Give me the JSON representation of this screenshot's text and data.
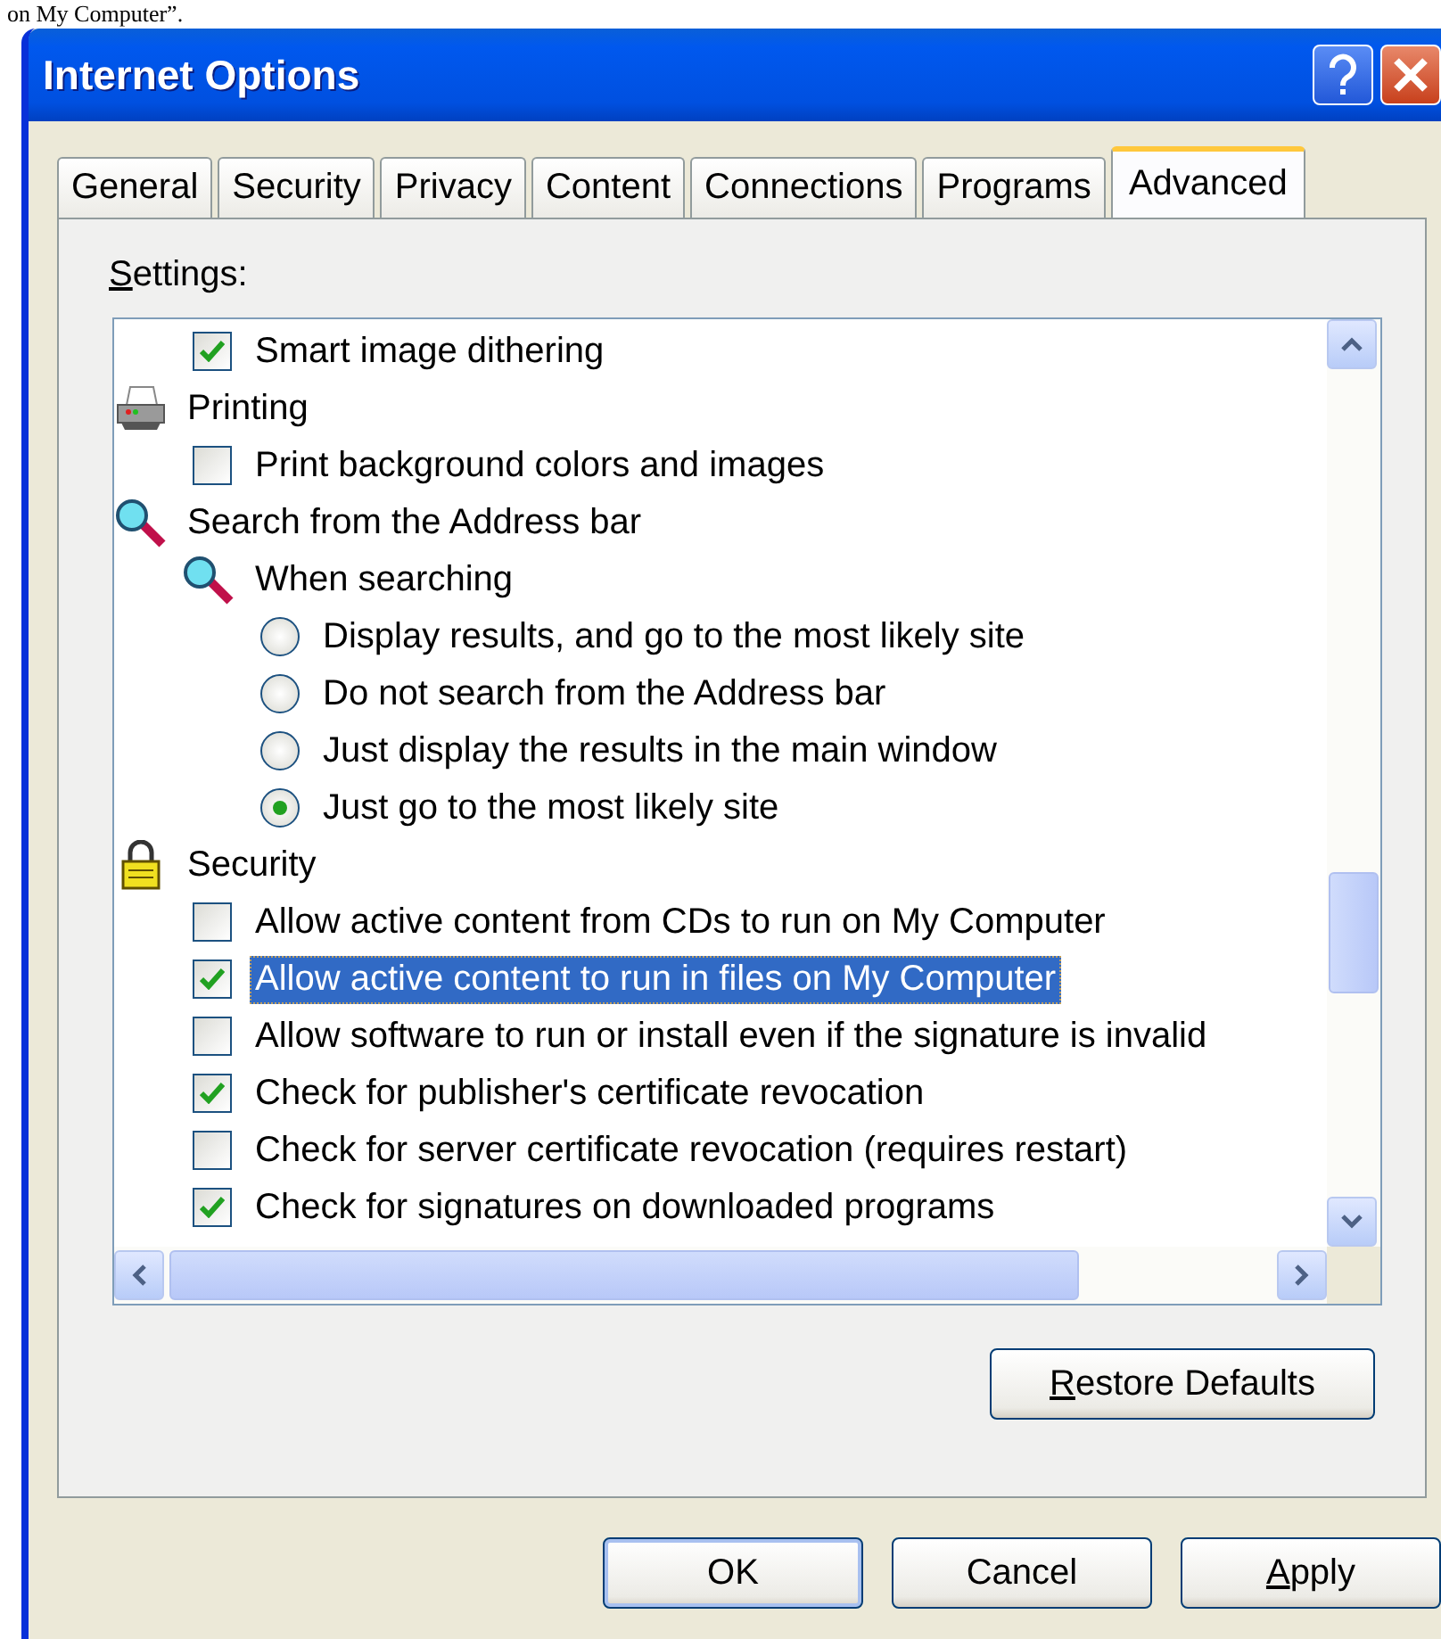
{
  "background_text": "on My Computer”.",
  "window": {
    "title": "Internet Options"
  },
  "tabs": [
    {
      "label": "General",
      "selected": false
    },
    {
      "label": "Security",
      "selected": false
    },
    {
      "label": "Privacy",
      "selected": false
    },
    {
      "label": "Content",
      "selected": false
    },
    {
      "label": "Connections",
      "selected": false
    },
    {
      "label": "Programs",
      "selected": false
    },
    {
      "label": "Advanced",
      "selected": true
    }
  ],
  "settings_label": {
    "access_key": "S",
    "text_after_key": "ettings:"
  },
  "settings_list": {
    "continued": [
      {
        "kind": "checkbox",
        "label": "Smart image dithering",
        "checked": true,
        "selected": false
      }
    ],
    "groups": [
      {
        "kind": "printer",
        "label": "Printing",
        "children": [
          {
            "kind": "checkbox",
            "label": "Print background colors and images",
            "checked": false,
            "selected": false
          }
        ]
      },
      {
        "kind": "search",
        "label": "Search from the Address bar",
        "children": [
          {
            "kind": "search",
            "label": "When searching",
            "children": [
              {
                "kind": "radio",
                "label": "Display results, and go to the most likely site",
                "checked": false,
                "selected": false
              },
              {
                "kind": "radio",
                "label": "Do not search from the Address bar",
                "checked": false,
                "selected": false
              },
              {
                "kind": "radio",
                "label": "Just display the results in the main window",
                "checked": false,
                "selected": false
              },
              {
                "kind": "radio",
                "label": "Just go to the most likely site",
                "checked": true,
                "selected": false
              }
            ]
          }
        ]
      },
      {
        "kind": "lock",
        "label": "Security",
        "children": [
          {
            "kind": "checkbox",
            "label": "Allow active content from CDs to run on My Computer",
            "checked": false,
            "selected": false
          },
          {
            "kind": "checkbox",
            "label": "Allow active content to run in files on My Computer",
            "checked": true,
            "selected": true
          },
          {
            "kind": "checkbox",
            "label": "Allow software to run or install even if the signature is invalid",
            "checked": false,
            "selected": false
          },
          {
            "kind": "checkbox",
            "label": "Check for publisher's certificate revocation",
            "checked": true,
            "selected": false
          },
          {
            "kind": "checkbox",
            "label": "Check for server certificate revocation (requires restart)",
            "checked": false,
            "selected": false
          },
          {
            "kind": "checkbox",
            "label": "Check for signatures on downloaded programs",
            "checked": true,
            "selected": false
          }
        ]
      }
    ]
  },
  "restore_button": {
    "access_key": "R",
    "text_after_key": "estore Defaults"
  },
  "dialog_buttons": [
    {
      "label": "OK",
      "default": true
    },
    {
      "label": "Cancel",
      "default": false
    },
    {
      "access_key": "A",
      "text_after_key": "pply",
      "default": false
    }
  ]
}
